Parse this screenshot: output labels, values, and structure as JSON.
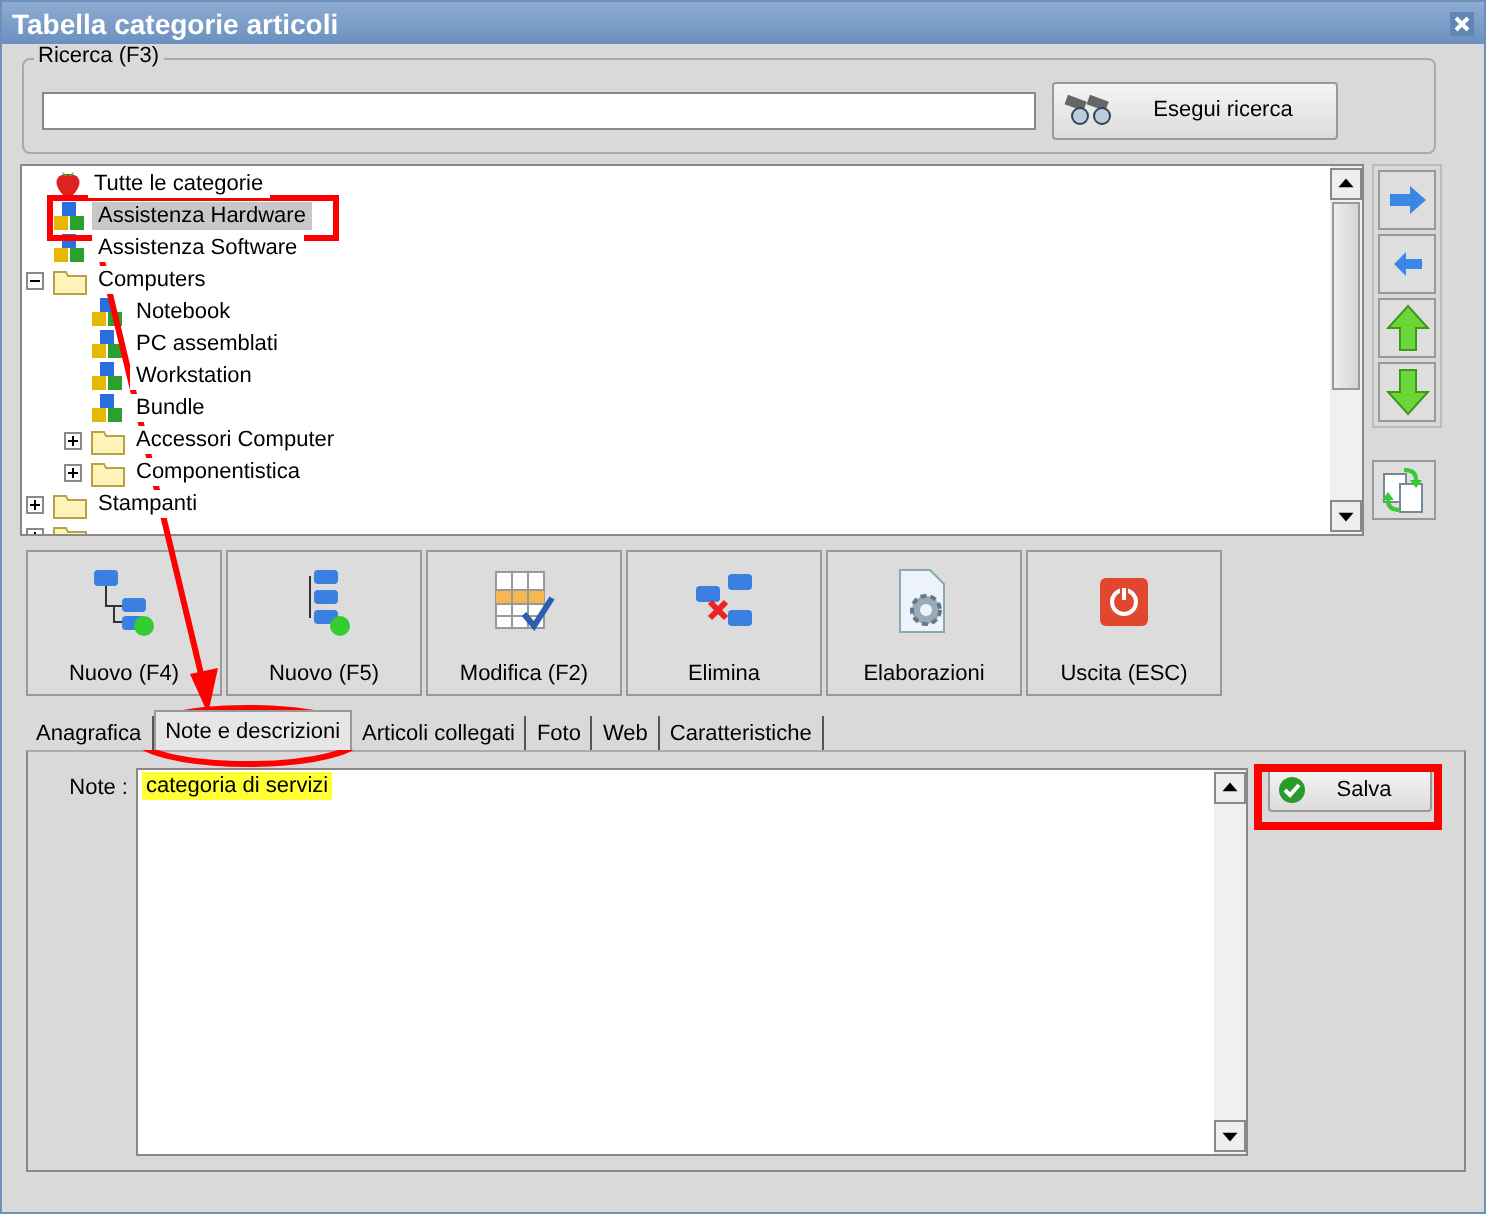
{
  "window": {
    "title": "Tabella categorie articoli"
  },
  "search": {
    "label": "Ricerca (F3)",
    "button": "Esegui ricerca"
  },
  "tree": {
    "items": [
      {
        "label": "Tutte le categorie",
        "kind": "root",
        "selected": false,
        "children": [
          {
            "label": "Assistenza Hardware",
            "kind": "category",
            "selected": true
          },
          {
            "label": "Assistenza Software",
            "kind": "category",
            "selected": false
          },
          {
            "label": "Computers",
            "kind": "folder",
            "expanded": true,
            "selected": false,
            "children": [
              {
                "label": "Notebook",
                "kind": "category",
                "selected": false
              },
              {
                "label": "PC assemblati",
                "kind": "category",
                "selected": false
              },
              {
                "label": "Workstation",
                "kind": "category",
                "selected": false
              },
              {
                "label": "Bundle",
                "kind": "category",
                "selected": false
              },
              {
                "label": "Accessori Computer",
                "kind": "folder",
                "expanded": false,
                "selected": false
              },
              {
                "label": "Componentistica",
                "kind": "folder",
                "expanded": false,
                "selected": false
              }
            ]
          },
          {
            "label": "Stampanti",
            "kind": "folder",
            "expanded": false,
            "selected": false
          },
          {
            "kind": "folder",
            "expanded": false,
            "selected": false
          }
        ]
      }
    ]
  },
  "side_buttons": [
    {
      "kind": "right"
    },
    {
      "kind": "left"
    },
    {
      "kind": "up"
    },
    {
      "kind": "down"
    }
  ],
  "toolbar": [
    {
      "label": "Nuovo (F4)",
      "kind": "new-sibling"
    },
    {
      "label": "Nuovo (F5)",
      "kind": "new-child"
    },
    {
      "label": "Modifica (F2)",
      "kind": "edit"
    },
    {
      "label": "Elimina",
      "kind": "delete"
    },
    {
      "label": "Elaborazioni",
      "kind": "process"
    },
    {
      "label": "Uscita (ESC)",
      "kind": "exit"
    }
  ],
  "tabs": [
    {
      "label": "Anagrafica",
      "selected": false
    },
    {
      "label": "Note e descrizioni",
      "selected": true
    },
    {
      "label": "Articoli collegati",
      "selected": false
    },
    {
      "label": "Foto",
      "selected": false
    },
    {
      "label": "Web",
      "selected": false
    },
    {
      "label": "Caratteristiche",
      "selected": false
    }
  ],
  "note": {
    "label": "Note :",
    "value": "categoria di servizi"
  },
  "save_button": "Salva"
}
